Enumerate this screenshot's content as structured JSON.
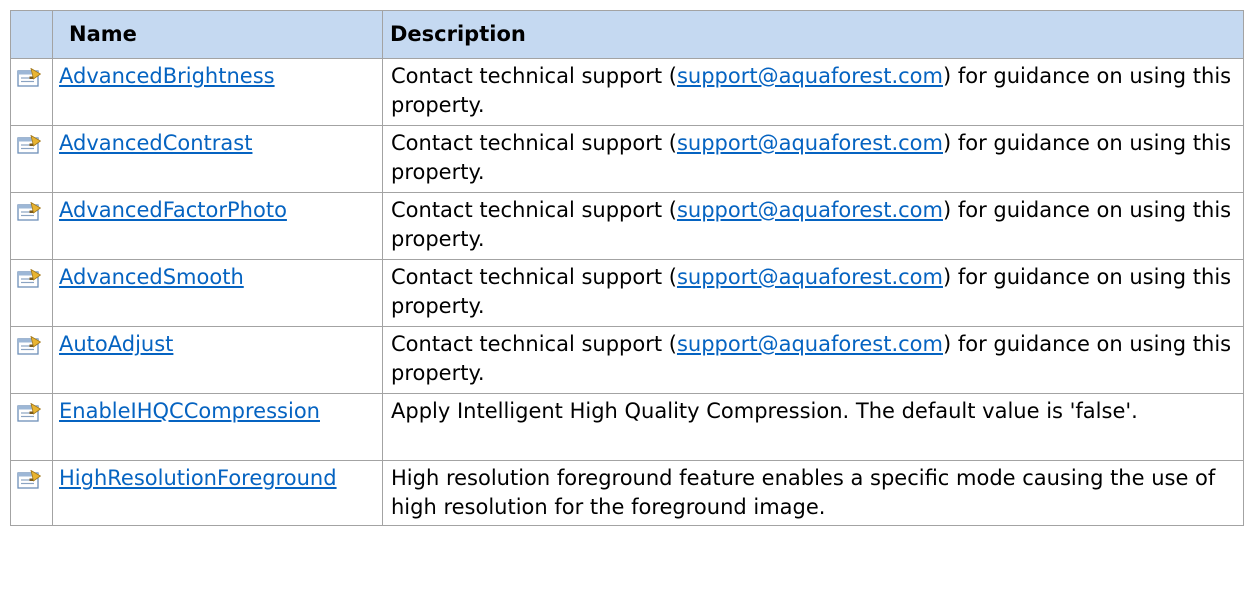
{
  "table": {
    "headers": {
      "name": "Name",
      "description": "Description"
    },
    "rows": [
      {
        "name": "AdvancedBrightness",
        "desc_before": "Contact technical support (",
        "email": "support@aquaforest.com",
        "desc_after": ") for guidance on using this property."
      },
      {
        "name": "AdvancedContrast",
        "desc_before": "Contact technical support (",
        "email": "support@aquaforest.com",
        "desc_after": ") for guidance on using this property."
      },
      {
        "name": "AdvancedFactorPhoto",
        "desc_before": "Contact technical support (",
        "email": "support@aquaforest.com",
        "desc_after": ") for guidance on using this property."
      },
      {
        "name": "AdvancedSmooth",
        "desc_before": "Contact technical support (",
        "email": "support@aquaforest.com",
        "desc_after": ") for guidance on using this property."
      },
      {
        "name": "AutoAdjust",
        "desc_before": "Contact technical support (",
        "email": "support@aquaforest.com",
        "desc_after": ") for guidance on using this property."
      },
      {
        "name": "EnableIHQCCompression",
        "description": "Apply Intelligent High Quality Compression. The default value is 'false'."
      },
      {
        "name": "HighResolutionForeground",
        "description": "High resolution foreground feature enables a specific mode causing the use of high resolution for the foreground image."
      }
    ]
  },
  "icons": {
    "row_icon": "property-icon"
  },
  "colors": {
    "header_bg": "#c5d9f1",
    "link": "#0563c1",
    "border": "#a3a3a3"
  }
}
